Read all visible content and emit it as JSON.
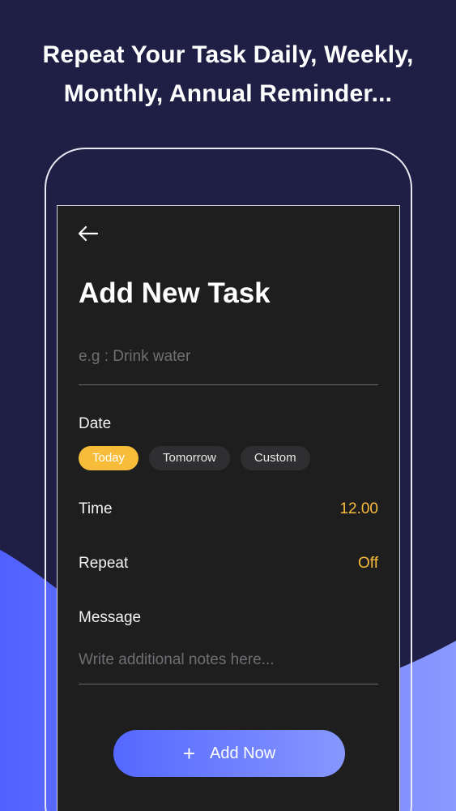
{
  "headline": {
    "line1": "Repeat Your Task Daily, Weekly,",
    "line2": "Monthly, Annual Reminder..."
  },
  "icons": {
    "back": "arrow-left-icon",
    "add": "plus-icon"
  },
  "colors": {
    "background": "#1f1f45",
    "accent_blue": "#5468ff",
    "accent_yellow": "#f6bc3a",
    "screen_bg": "#1e1e1f"
  },
  "screen": {
    "title": "Add New Task",
    "task_input": {
      "placeholder": "e.g : Drink water",
      "value": ""
    },
    "date": {
      "label": "Date",
      "options": [
        "Today",
        "Tomorrow",
        "Custom"
      ],
      "selected": "Today"
    },
    "time": {
      "label": "Time",
      "value": "12.00"
    },
    "repeat": {
      "label": "Repeat",
      "value": "Off"
    },
    "message": {
      "label": "Message",
      "placeholder": "Write additional notes here...",
      "value": ""
    },
    "add_button": {
      "label": "Add Now"
    }
  }
}
